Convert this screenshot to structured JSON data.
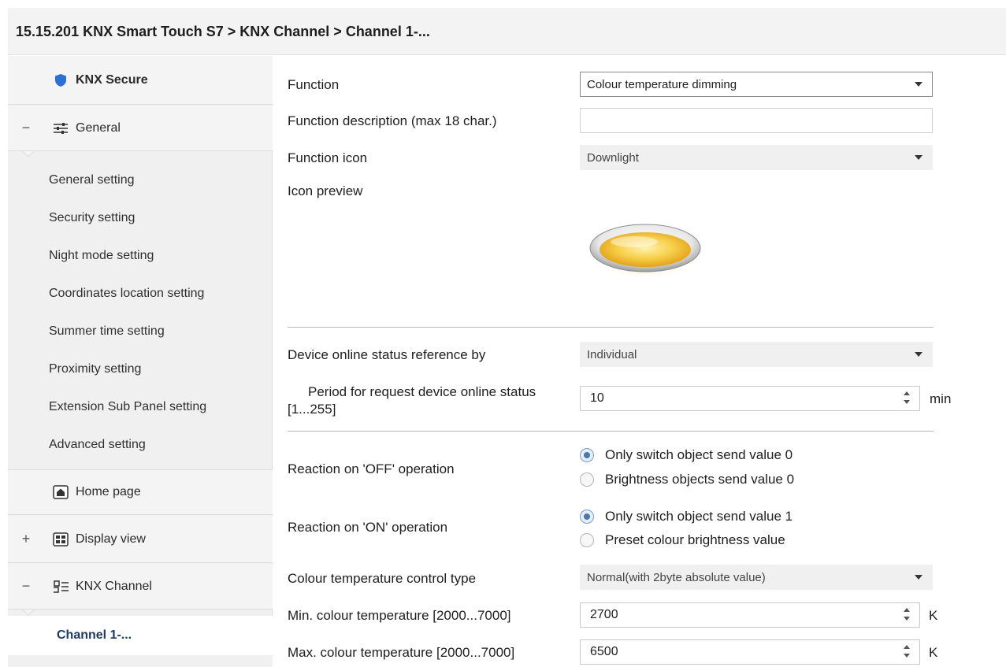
{
  "breadcrumb": "15.15.201 KNX Smart Touch S7 > KNX Channel  > Channel 1-...",
  "sidebar": {
    "secure": "KNX Secure",
    "general": {
      "toggle": "−",
      "label": "General"
    },
    "general_items": [
      "General setting",
      "Security setting",
      "Night mode setting",
      "Coordinates location setting",
      "Summer time setting",
      "Proximity setting",
      "Extension Sub Panel setting",
      "Advanced setting"
    ],
    "home": "Home page",
    "display": {
      "toggle": "+",
      "label": "Display view"
    },
    "channel_group": {
      "toggle": "−",
      "label": "KNX Channel"
    },
    "channel_item": "Channel 1-..."
  },
  "form": {
    "function": {
      "label": "Function",
      "value": "Colour temperature dimming"
    },
    "description": {
      "label": "Function description (max 18 char.)",
      "value": ""
    },
    "icon": {
      "label": "Function icon",
      "value": "Downlight"
    },
    "preview": {
      "label": "Icon preview"
    },
    "online_ref": {
      "label": "Device online status reference by",
      "value": "Individual"
    },
    "period": {
      "label_line1": "Period for request device online status",
      "label_line2": "[1...255]",
      "value": "10",
      "unit": "min"
    },
    "off_reaction": {
      "label": "Reaction on 'OFF' operation",
      "options": [
        "Only switch object send value 0",
        "Brightness objects send value 0"
      ],
      "selected": 0
    },
    "on_reaction": {
      "label": "Reaction on 'ON' operation",
      "options": [
        "Only switch object send value 1",
        "Preset colour brightness value"
      ],
      "selected": 0
    },
    "ct_type": {
      "label": "Colour temperature control type",
      "value": "Normal(with 2byte absolute value)"
    },
    "min_ct": {
      "label": "Min. colour temperature [2000...7000]",
      "value": "2700",
      "unit": "K"
    },
    "max_ct": {
      "label": "Max. colour temperature [2000...7000]",
      "value": "6500",
      "unit": "K"
    }
  },
  "colors": {
    "accent": "#1f3b60",
    "shield": "#2e6fd6",
    "lamp": "#f5c242",
    "sidebar_bg": "#f0f0f0"
  }
}
